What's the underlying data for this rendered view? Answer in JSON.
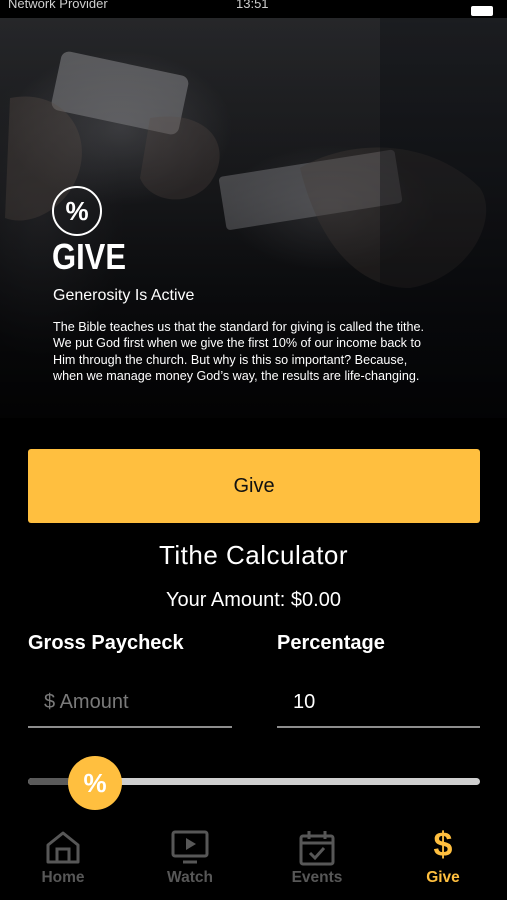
{
  "status_bar": {
    "carrier": "Network Provider",
    "time": "13:51"
  },
  "hero": {
    "badge_symbol": "%",
    "title": "GIVE",
    "subtitle": "Generosity Is Active",
    "body": "The Bible teaches us that the standard for giving is called the tithe. We put God first when we give the first 10% of our income back to Him through the church. But why is this so important? Because, when we manage money God’s way, the results are life-changing."
  },
  "give_button": {
    "label": "Give"
  },
  "calculator": {
    "title": "Tithe Calculator",
    "amount_text": "Your Amount: $0.00",
    "gross_label": "Gross Paycheck",
    "gross_placeholder": "$ Amount",
    "gross_value": "",
    "percentage_label": "Percentage",
    "percentage_value": "10",
    "slider_symbol": "%",
    "slider_fraction": 0.14
  },
  "tabs": [
    {
      "label": "Home",
      "icon": "home-icon",
      "active": false
    },
    {
      "label": "Watch",
      "icon": "watch-icon",
      "active": false
    },
    {
      "label": "Events",
      "icon": "calendar-icon",
      "active": false
    },
    {
      "label": "Give",
      "icon": "dollar-icon",
      "symbol": "$",
      "active": true
    }
  ],
  "colors": {
    "accent": "#ffbf3f",
    "background": "#000000",
    "inactive_tab": "#575757"
  }
}
